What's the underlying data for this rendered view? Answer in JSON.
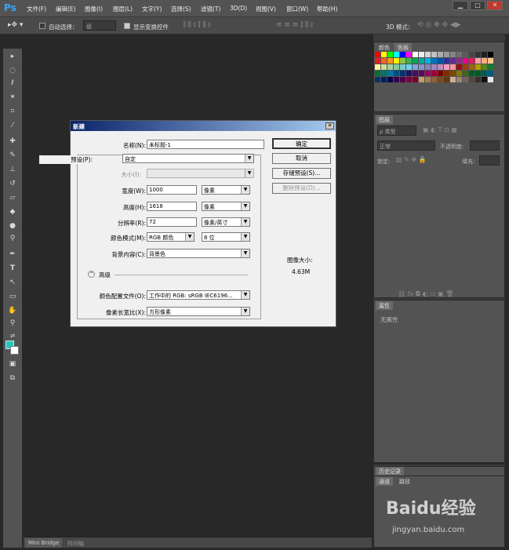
{
  "app": {
    "logo": "Ps"
  },
  "menu": [
    "文件(F)",
    "编辑(E)",
    "图像(I)",
    "图层(L)",
    "文字(Y)",
    "选择(S)",
    "滤镜(T)",
    "3D(D)",
    "视图(V)",
    "窗口(W)",
    "帮助(H)"
  ],
  "window_controls": {
    "minimize": "▁",
    "maximize": "□",
    "close": "✕"
  },
  "options_bar": {
    "auto_select_label": "自动选择：",
    "auto_select_value": "组",
    "show_transform_label": "显示变换控件",
    "mode_3d_label": "3D 模式："
  },
  "panels": {
    "color_tab": "颜色",
    "swatches_tab": "色板",
    "layers_tab": "图层",
    "kind_filter": "ρ 类型",
    "blend_mode": "正常",
    "opacity_label": "不透明度:",
    "lock_label": "锁定:",
    "fill_label": "填充:",
    "properties_tab": "属性",
    "no_properties": "无属性",
    "history_tab": "历史记录",
    "channels_tab": "通道",
    "paths_tab": "路径"
  },
  "bottom_tabs": [
    "Mini Bridge",
    "时间轴"
  ],
  "dialog": {
    "title": "新建",
    "name_label": "名称(N):",
    "name_value": "未标题-1",
    "preset_label": "预设(P):",
    "preset_value": "自定",
    "size_label": "大小(I):",
    "size_value": "",
    "width_label": "宽度(W):",
    "width_value": "1000",
    "width_unit": "像素",
    "height_label": "高度(H):",
    "height_value": "1618",
    "height_unit": "像素",
    "resolution_label": "分辨率(R):",
    "resolution_value": "72",
    "resolution_unit": "像素/英寸",
    "color_mode_label": "颜色模式(M):",
    "color_mode_value": "RGB 颜色",
    "bit_depth": "8 位",
    "bg_label": "背景内容(C):",
    "bg_value": "背景色",
    "advanced_label": "高级",
    "profile_label": "颜色配置文件(O):",
    "profile_value": "工作中的 RGB: sRGB IEC6196...",
    "pixel_aspect_label": "像素长宽比(X):",
    "pixel_aspect_value": "方形像素",
    "ok": "确定",
    "cancel": "取消",
    "save_preset": "存储预设(S)...",
    "delete_preset": "删除预设(D)...",
    "image_size_label": "图像大小:",
    "image_size_value": "4.63M"
  },
  "watermark": {
    "brand": "Baidu经验",
    "url": "jingyan.baidu.com"
  },
  "colors": {
    "fg": "#20c8c0",
    "bg": "#ffffff",
    "dialog_title_start": "#0a246a",
    "dialog_title_end": "#a6caf0"
  }
}
